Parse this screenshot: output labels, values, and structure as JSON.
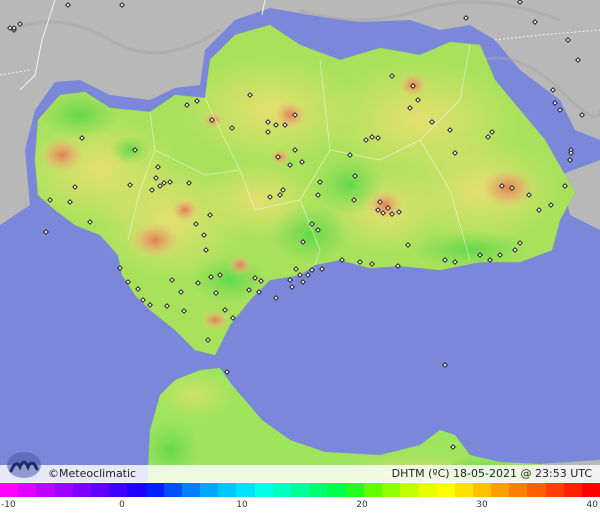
{
  "brand": {
    "name": "©Meteoclimatic",
    "logo_icon": "meteoclimatic-logo-icon"
  },
  "caption": {
    "variable": "DHTM (ºC)",
    "date": "18-05-2021",
    "time": "@ 23:53 UTC"
  },
  "legend": {
    "ticks": [
      "-10",
      "0",
      "10",
      "20",
      "30",
      "40"
    ],
    "colors": [
      "#ff00ff",
      "#e000ff",
      "#c000ff",
      "#a000ff",
      "#8000ff",
      "#6000ff",
      "#4000ff",
      "#2000ff",
      "#0020ff",
      "#0050ff",
      "#0080ff",
      "#00a8ff",
      "#00c8ff",
      "#00e0ff",
      "#00ffe8",
      "#00ffc0",
      "#00ff98",
      "#00ff70",
      "#00ff48",
      "#20ff20",
      "#60ff00",
      "#90ff00",
      "#c0ff00",
      "#e8ff00",
      "#ffff00",
      "#ffe000",
      "#ffc000",
      "#ffa000",
      "#ff8000",
      "#ff6000",
      "#ff4000",
      "#ff2000",
      "#ff0000"
    ]
  },
  "map_colors": {
    "sea": "#7b88d9",
    "land_outside": "#b9b9b9",
    "region_base": "#9ee45c",
    "warm": "#e8e46a",
    "hot": "#e8a070",
    "station_marker": "#222222"
  }
}
